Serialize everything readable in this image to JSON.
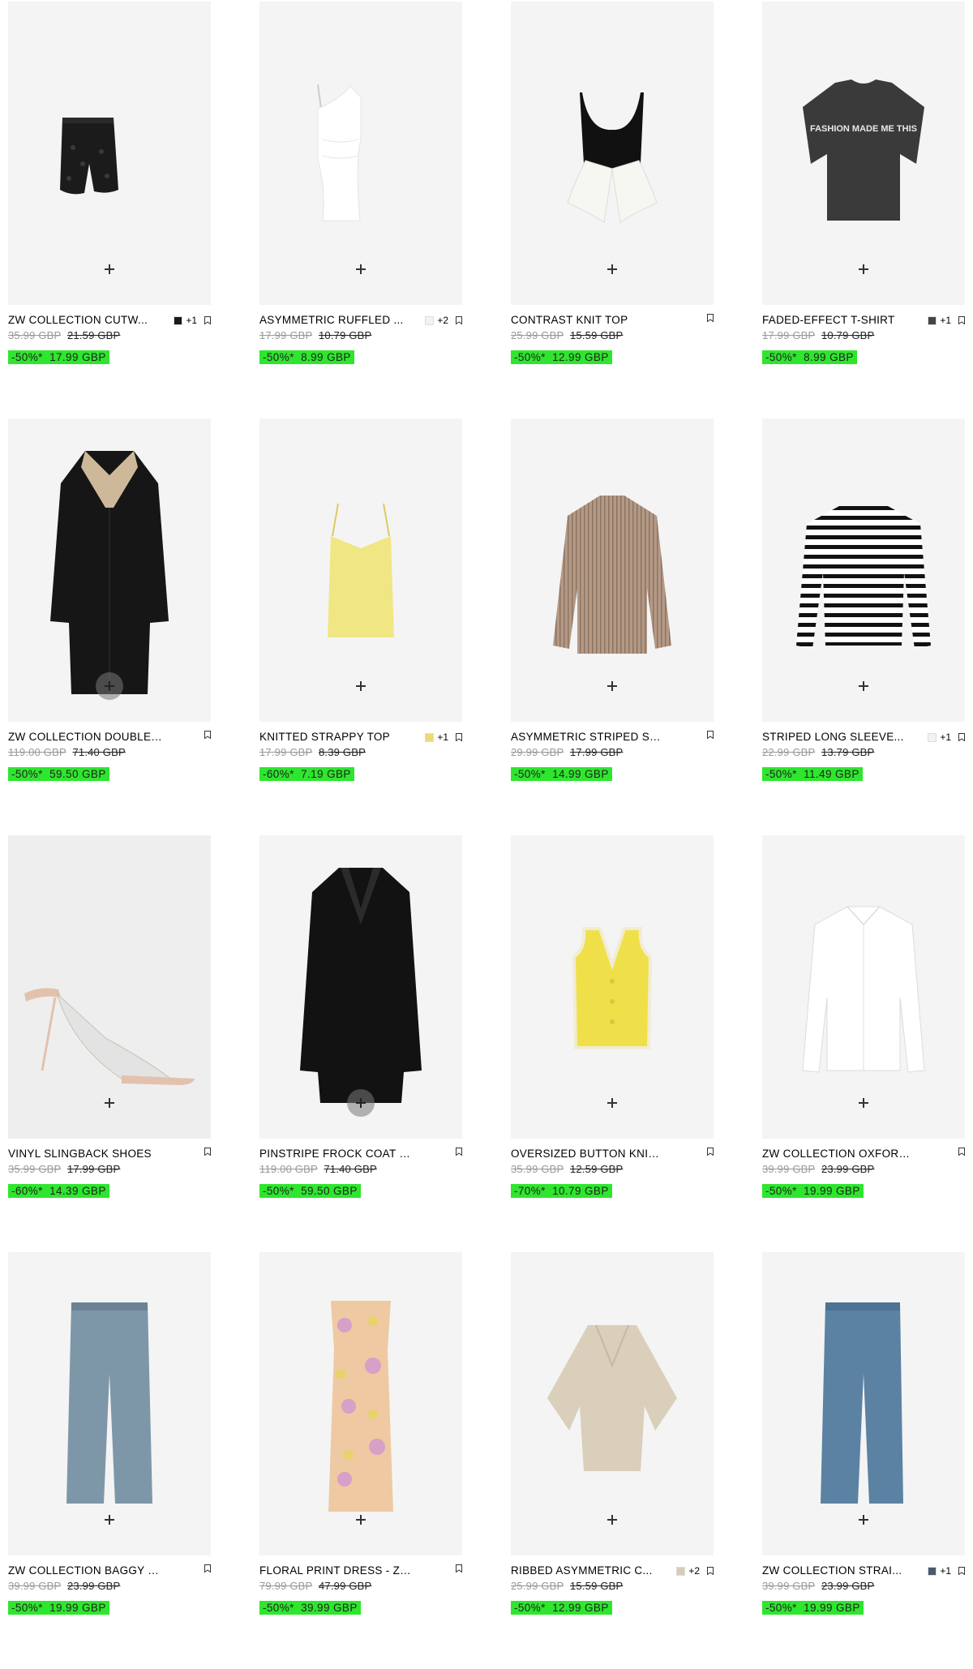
{
  "products": [
    {
      "name": "ZW COLLECTION CUTW...",
      "swatch": "#1a1a1a",
      "more": "+1",
      "original": "35.99 GBP",
      "previous": "21.59 GBP",
      "discount": "-50%*",
      "sale": "17.99 GBP",
      "icon": "cutwork-shorts"
    },
    {
      "name": "ASYMMETRIC RUFFLED ...",
      "swatch": "#f2f2f2",
      "more": "+2",
      "original": "17.99 GBP",
      "previous": "10.79 GBP",
      "discount": "-50%*",
      "sale": "8.99 GBP",
      "icon": "white-top"
    },
    {
      "name": "CONTRAST KNIT TOP",
      "swatch": "",
      "more": "",
      "original": "25.99 GBP",
      "previous": "15.59 GBP",
      "discount": "-50%*",
      "sale": "12.99 GBP",
      "icon": "knit-top"
    },
    {
      "name": "FADED-EFFECT T-SHIRT",
      "swatch": "#444444",
      "more": "+1",
      "original": "17.99 GBP",
      "previous": "10.79 GBP",
      "discount": "-50%*",
      "sale": "8.99 GBP",
      "icon": "tshirt"
    },
    {
      "name": "ZW COLLECTION DOUBLE-FA...",
      "swatch": "",
      "more": "",
      "original": "119.00 GBP",
      "previous": "71.40 GBP",
      "discount": "-50%*",
      "sale": "59.50 GBP",
      "icon": "leather-coat"
    },
    {
      "name": "KNITTED STRAPPY TOP",
      "swatch": "#e8dc7a",
      "more": "+1",
      "original": "17.99 GBP",
      "previous": "8.39 GBP",
      "discount": "-60%*",
      "sale": "7.19 GBP",
      "icon": "strappy-top"
    },
    {
      "name": "ASYMMETRIC STRIPED SHIRT...",
      "swatch": "",
      "more": "",
      "original": "29.99 GBP",
      "previous": "17.99 GBP",
      "discount": "-50%*",
      "sale": "14.99 GBP",
      "icon": "striped-shirt"
    },
    {
      "name": "STRIPED LONG SLEEVE...",
      "swatch": "#f2f2f2",
      "more": "+1",
      "original": "22.99 GBP",
      "previous": "13.79 GBP",
      "discount": "-50%*",
      "sale": "11.49 GBP",
      "icon": "breton-top"
    },
    {
      "name": "VINYL SLINGBACK SHOES",
      "swatch": "",
      "more": "",
      "original": "35.99 GBP",
      "previous": "17.99 GBP",
      "discount": "-60%*",
      "sale": "14.39 GBP",
      "icon": "slingback-shoes"
    },
    {
      "name": "PINSTRIPE FROCK COAT ZW ...",
      "swatch": "",
      "more": "",
      "original": "119.00 GBP",
      "previous": "71.40 GBP",
      "discount": "-50%*",
      "sale": "59.50 GBP",
      "icon": "black-coat"
    },
    {
      "name": "OVERSIZED BUTTON KNITTE...",
      "swatch": "",
      "more": "",
      "original": "35.99 GBP",
      "previous": "12.59 GBP",
      "discount": "-70%*",
      "sale": "10.79 GBP",
      "icon": "knit-vest"
    },
    {
      "name": "ZW COLLECTION OXFORD SH...",
      "swatch": "",
      "more": "",
      "original": "39.99 GBP",
      "previous": "23.99 GBP",
      "discount": "-50%*",
      "sale": "19.99 GBP",
      "icon": "white-shirt"
    },
    {
      "name": "ZW COLLECTION BAGGY LO...",
      "swatch": "",
      "more": "",
      "original": "39.99 GBP",
      "previous": "23.99 GBP",
      "discount": "-50%*",
      "sale": "19.99 GBP",
      "icon": "baggy-jeans"
    },
    {
      "name": "FLORAL PRINT DRESS - ZW ...",
      "swatch": "",
      "more": "",
      "original": "79.99 GBP",
      "previous": "47.99 GBP",
      "discount": "-50%*",
      "sale": "39.99 GBP",
      "icon": "floral-dress"
    },
    {
      "name": "RIBBED ASYMMETRIC C...",
      "swatch": "#d8cdb4",
      "more": "+2",
      "original": "25.99 GBP",
      "previous": "15.59 GBP",
      "discount": "-50%*",
      "sale": "12.99 GBP",
      "icon": "poncho-top"
    },
    {
      "name": "ZW COLLECTION STRAI...",
      "swatch": "#4a5a6e",
      "more": "+1",
      "original": "39.99 GBP",
      "previous": "23.99 GBP",
      "discount": "-50%*",
      "sale": "19.99 GBP",
      "icon": "straight-jeans"
    }
  ],
  "tshirt_print": "FASHION MADE ME THIS",
  "colors": {
    "sale_badge": "#2ee62e",
    "image_bg": "#f4f4f4",
    "original_price": "#999999"
  }
}
